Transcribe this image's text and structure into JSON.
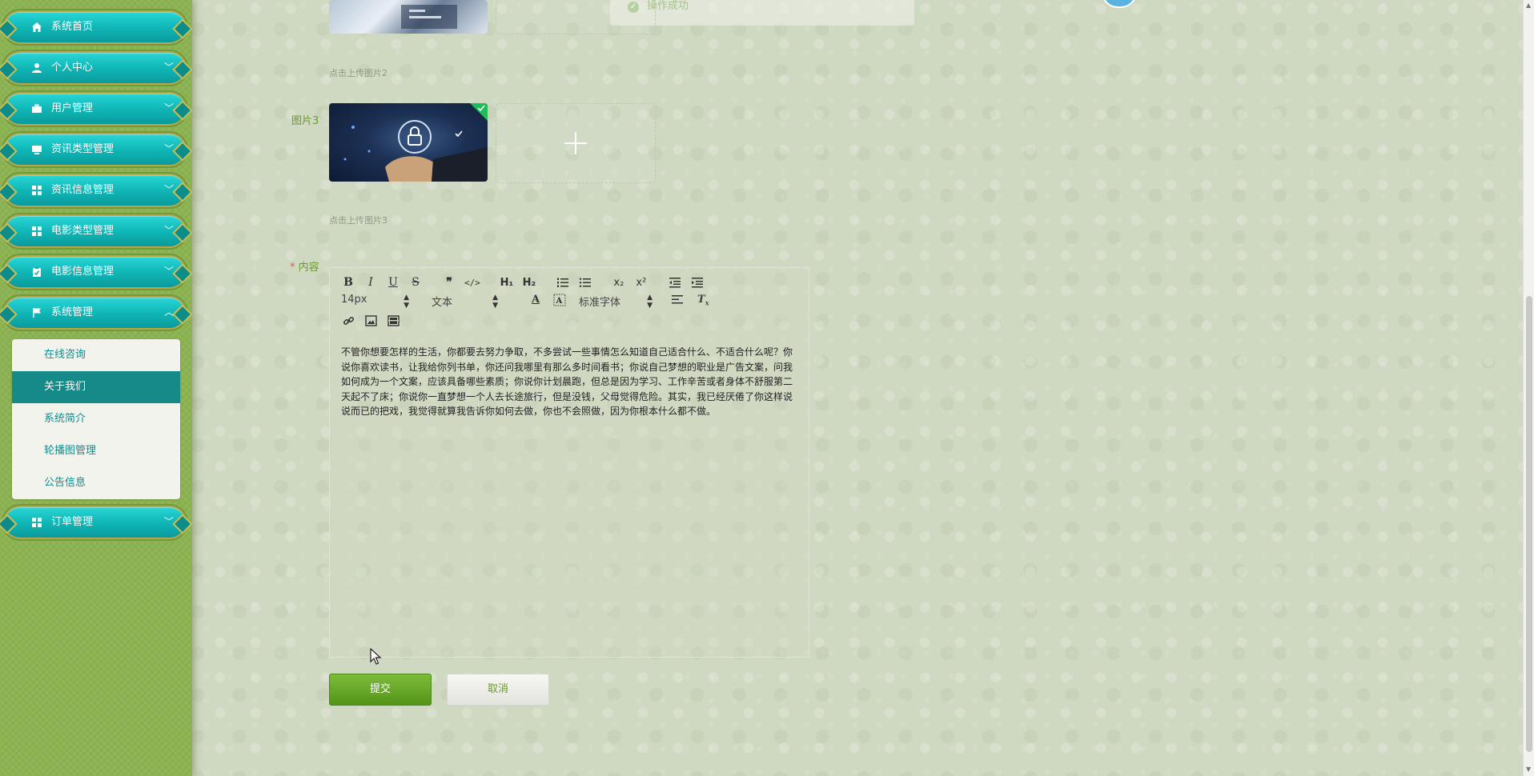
{
  "sidebar": {
    "menu": [
      {
        "label": "系统首页",
        "icon": "home-icon",
        "chevron": ""
      },
      {
        "label": "个人中心",
        "icon": "user-icon",
        "chevron": "﹀"
      },
      {
        "label": "用户管理",
        "icon": "briefcase-icon",
        "chevron": "﹀"
      },
      {
        "label": "资讯类型管理",
        "icon": "monitor-icon",
        "chevron": "﹀"
      },
      {
        "label": "资讯信息管理",
        "icon": "grid-icon",
        "chevron": "﹀"
      },
      {
        "label": "电影类型管理",
        "icon": "grid-icon",
        "chevron": "﹀"
      },
      {
        "label": "电影信息管理",
        "icon": "clipboard-check-icon",
        "chevron": "﹀"
      },
      {
        "label": "系统管理",
        "icon": "flag-icon",
        "chevron": "︿"
      },
      {
        "label": "订单管理",
        "icon": "grid-icon",
        "chevron": "﹀"
      }
    ],
    "submenu": [
      {
        "label": "在线咨询",
        "active": false
      },
      {
        "label": "关于我们",
        "active": true
      },
      {
        "label": "系统简介",
        "active": false
      },
      {
        "label": "轮播图管理",
        "active": false
      },
      {
        "label": "公告信息",
        "active": false
      }
    ]
  },
  "toast": {
    "text": "操作成功",
    "icon": "check-circle-icon"
  },
  "form": {
    "image2_hint": "点击上传图片2",
    "image3_label": "图片3",
    "image3_hint": "点击上传图片3",
    "content_required": "*",
    "content_label": "内容"
  },
  "editor": {
    "font_size": "14px",
    "heading_select": "文本",
    "font_family": "标准字体",
    "content": "不管你想要怎样的生活，你都要去努力争取，不多尝试一些事情怎么知道自己适合什么、不适合什么呢？你说你喜欢读书，让我给你列书单，你还问我哪里有那么多时间看书；你说自己梦想的职业是广告文案，问我如何成为一个文案，应该具备哪些素质；你说你计划晨跑，但总是因为学习、工作辛苦或者身体不舒服第二天起不了床；你说你一直梦想一个人去长途旅行，但是没钱，父母觉得危险。其实，我已经厌倦了你这样说说而已的把戏，我觉得就算我告诉你如何去做，你也不会照做，因为你根本什么都不做。"
  },
  "buttons": {
    "submit": "提交",
    "cancel": "取消"
  },
  "colors": {
    "menu_teal": "#10b7b7",
    "label_green": "#6b9a2b",
    "submit_green": "#539419",
    "sidebar_green": "#8cb352"
  }
}
